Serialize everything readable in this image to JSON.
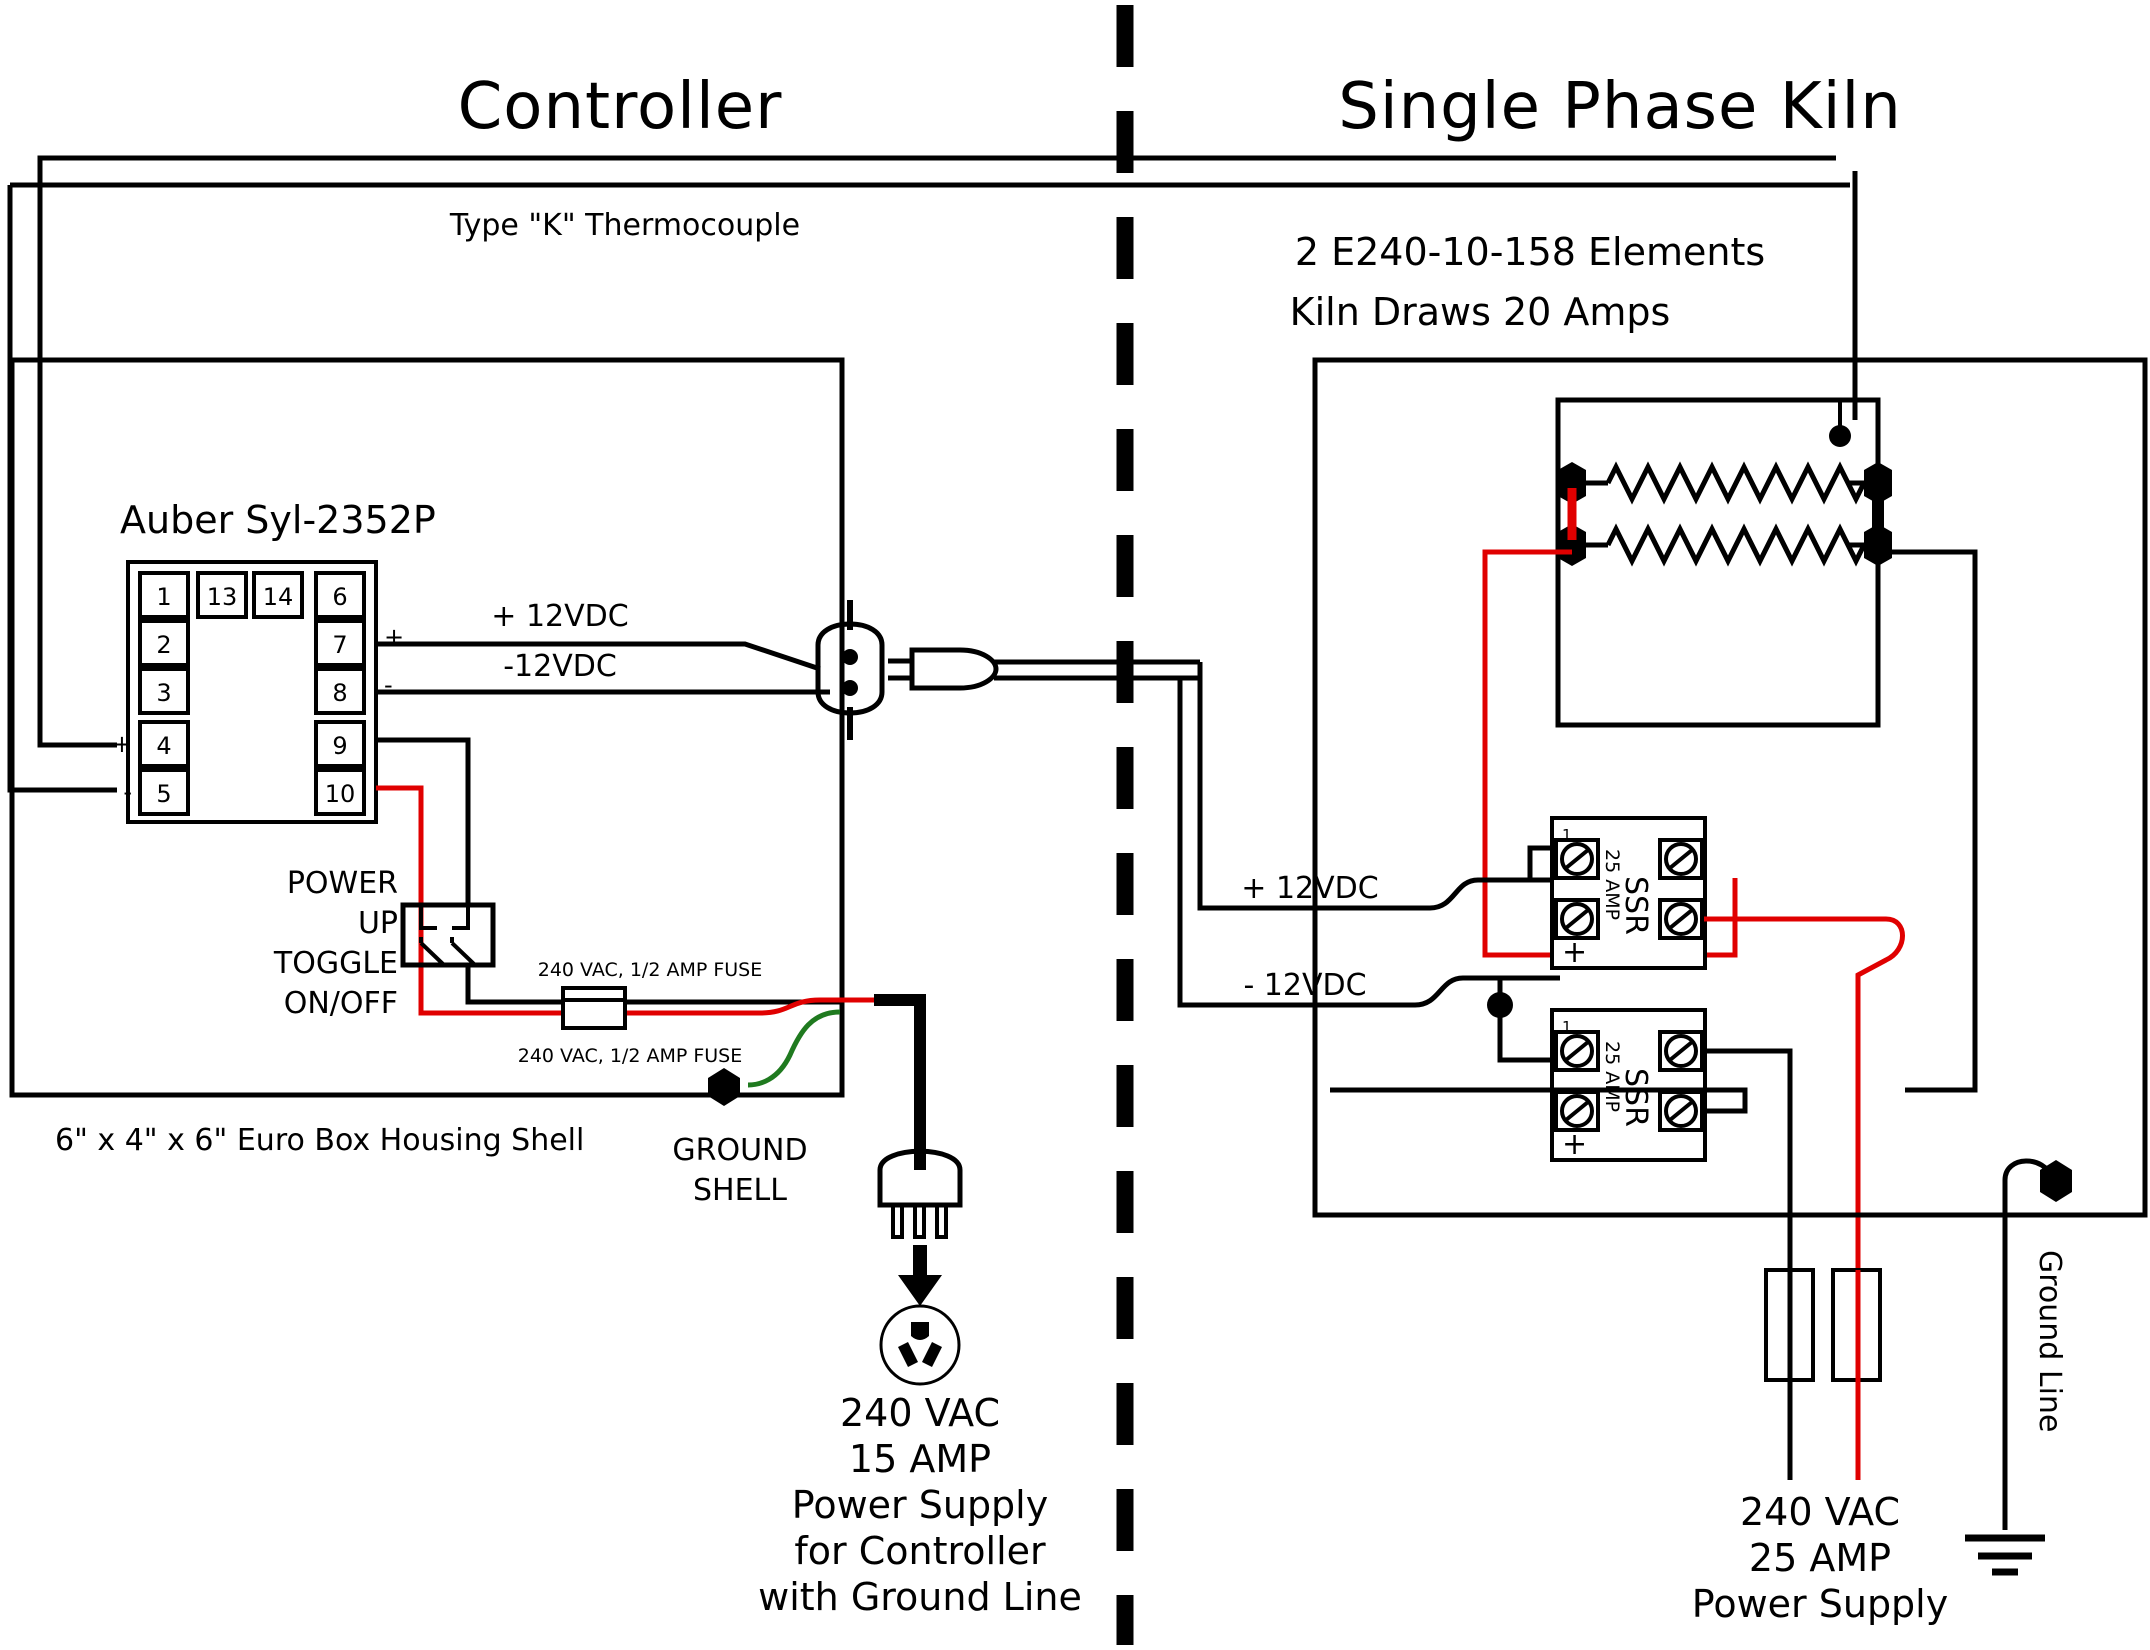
{
  "headers": {
    "controller": "Controller",
    "kiln": "Single Phase Kiln"
  },
  "controller": {
    "thermocouple_label": "Type \"K\" Thermocouple",
    "device_label": "Auber Syl-2352P",
    "terminals_left": [
      "1",
      "2",
      "3",
      "4",
      "5"
    ],
    "terminals_top_mid": [
      "13",
      "14"
    ],
    "terminals_right": [
      "6",
      "7",
      "8",
      "9",
      "10"
    ],
    "tc_plus": "+",
    "tc_minus": "-",
    "out_plus": "+",
    "out_minus": "-",
    "wire_plus_12vdc": "+ 12VDC",
    "wire_minus_12vdc": "-12VDC",
    "toggle_lines": [
      "POWER",
      "UP",
      "TOGGLE",
      "ON/OFF"
    ],
    "fuse_top": "240 VAC, 1/2 AMP FUSE",
    "fuse_bottom": "240 VAC, 1/2 AMP FUSE",
    "housing_label": "6\" x 4\" x 6\" Euro Box Housing Shell",
    "ground_shell_line1": "GROUND",
    "ground_shell_line2": "SHELL",
    "supply_lines": [
      "240 VAC",
      "15 AMP",
      "Power Supply",
      "for Controller",
      "with Ground Line"
    ]
  },
  "kiln": {
    "elements_line1": "2  E240-10-158 Elements",
    "elements_line2": "Kiln Draws 20 Amps",
    "wire_plus_12vdc": "+ 12VDC",
    "wire_minus_12vdc": "- 12VDC",
    "ssr": [
      {
        "name": "SSR",
        "rating": "25 AMP",
        "terminal_top": "1",
        "terminal_bottom": "+"
      },
      {
        "name": "SSR",
        "rating": "25 AMP",
        "terminal_top": "1",
        "terminal_bottom": "+"
      }
    ],
    "supply_lines": [
      "240 VAC",
      "25 AMP",
      "Power Supply"
    ],
    "ground_line_label": "Ground Line"
  },
  "colors": {
    "wire_black": "#000000",
    "wire_red": "#e00000",
    "wire_green": "#1f7a1f",
    "background": "#ffffff"
  }
}
